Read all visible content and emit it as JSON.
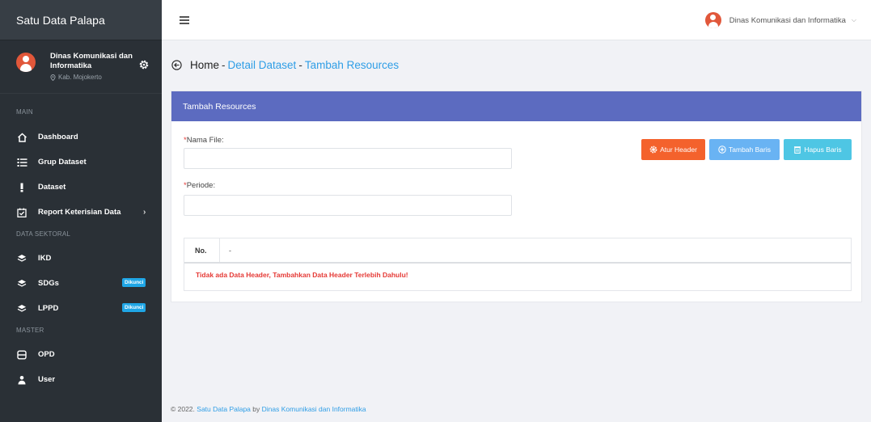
{
  "sidebar": {
    "brand": "Satu Data Palapa",
    "user_name": "Dinas Komunikasi dan Informatika",
    "user_location": "Kab. Mojokerto",
    "sections": {
      "main": "MAIN",
      "sektoral": "DATA SEKTORAL",
      "master": "MASTER"
    },
    "items": [
      {
        "label": "Dashboard",
        "icon": "home-icon"
      },
      {
        "label": "Grup Dataset",
        "icon": "list-icon"
      },
      {
        "label": "Dataset",
        "icon": "exclamation-icon"
      },
      {
        "label": "Report Keterisian Data",
        "icon": "calendar-check-icon"
      },
      {
        "label": "IKD",
        "icon": "layers-icon"
      },
      {
        "label": "SDGs",
        "icon": "layers-icon",
        "badge": "Dikunci"
      },
      {
        "label": "LPPD",
        "icon": "layers-icon",
        "badge": "Dikunci"
      },
      {
        "label": "OPD",
        "icon": "database-icon"
      },
      {
        "label": "User",
        "icon": "user-icon"
      }
    ]
  },
  "topbar": {
    "user_name": "Dinas Komunikasi dan Informatika"
  },
  "breadcrumb": {
    "home": "Home",
    "sep1": "-",
    "detail": "Detail Dataset",
    "sep2": "-",
    "current": "Tambah Resources"
  },
  "card": {
    "title": "Tambah Resources",
    "nama_file_label": "Nama File:",
    "periode_label": "Periode:",
    "required_mark": "*",
    "nama_file_value": "",
    "periode_value": "",
    "buttons": {
      "atur_header": "Atur Header",
      "tambah_baris": "Tambah Baris",
      "hapus_baris": "Hapus Baris"
    },
    "table": {
      "col_no": "No.",
      "col_dash": "-",
      "empty_message": "Tidak ada Data Header, Tambahkan Data Header Terlebih Dahulu!"
    }
  },
  "footer": {
    "prefix": "© 2022.",
    "app": "Satu Data Palapa",
    "by": "by",
    "org": "Dinas Komunikasi dan Informatika"
  },
  "colors": {
    "sidebar_bg": "#2a3036",
    "card_header": "#5c6bc0",
    "btn_orange": "#f4622c",
    "btn_blue": "#69b3f3",
    "btn_cyan": "#4ec6e4",
    "error_red": "#e53935",
    "link_blue": "#2f9ee6"
  }
}
